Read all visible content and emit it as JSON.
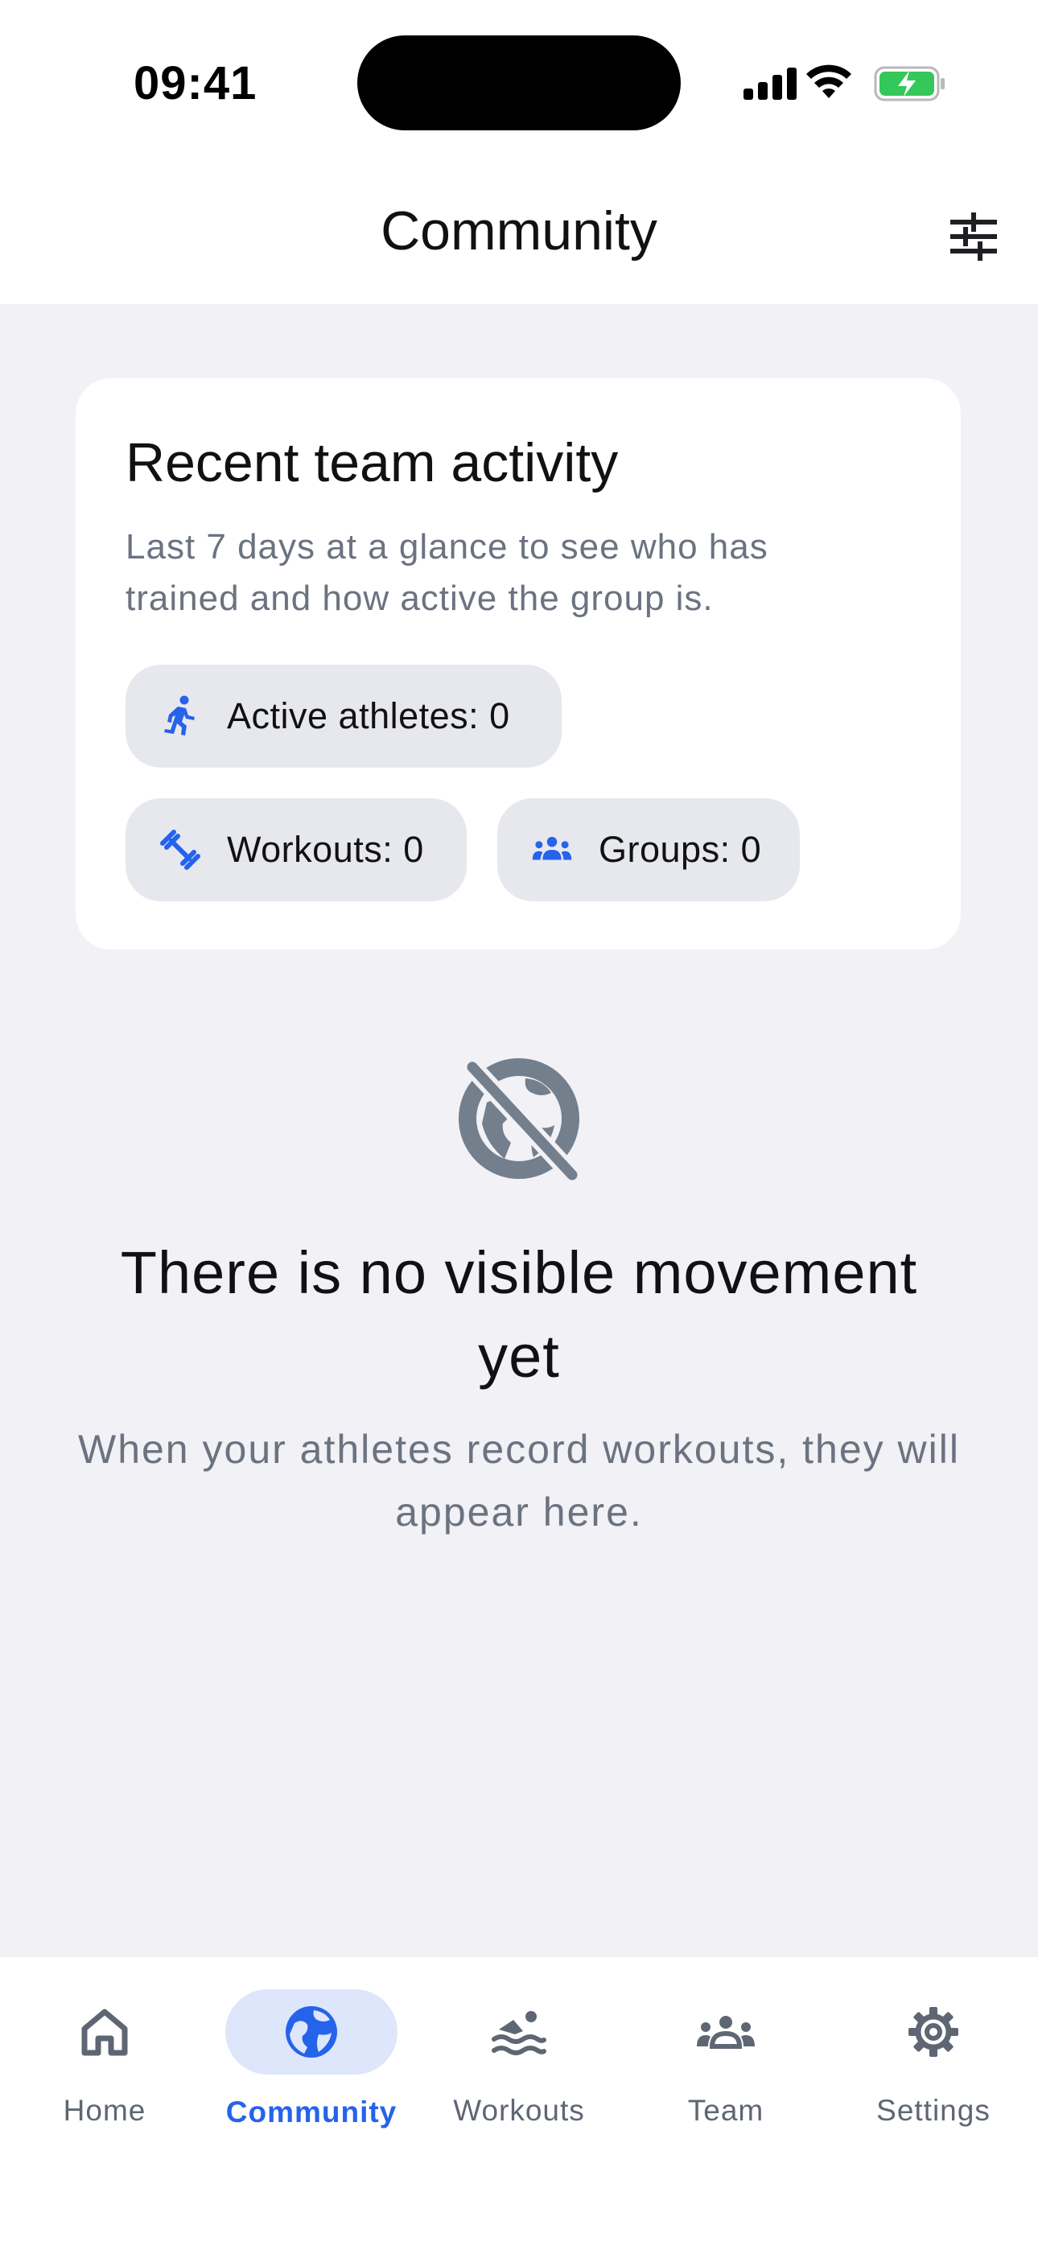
{
  "status_bar": {
    "time": "09:41"
  },
  "header": {
    "title": "Community",
    "filter_icon": "sliders-icon"
  },
  "activity_card": {
    "title": "Recent team activity",
    "description": "Last 7 days at a glance to see who has trained and how active the group is.",
    "chips": {
      "athletes": "Active athletes: 0",
      "workouts": "Workouts: 0",
      "groups": "Groups: 0"
    }
  },
  "empty_state": {
    "icon": "no-globe-icon",
    "title": "There is no visible movement yet",
    "description": "When your athletes record workouts, they will appear here."
  },
  "tab_bar": {
    "items": [
      {
        "label": "Home",
        "icon": "home-icon"
      },
      {
        "label": "Community",
        "icon": "globe-icon",
        "active": true
      },
      {
        "label": "Workouts",
        "icon": "swim-icon"
      },
      {
        "label": "Team",
        "icon": "team-icon"
      },
      {
        "label": "Settings",
        "icon": "gear-icon"
      }
    ]
  },
  "colors": {
    "accent": "#2563eb",
    "accent_bg": "#dde6fb",
    "background": "#f1f1f6",
    "chip_bg": "#e7e8ee",
    "muted_text": "#6b7280",
    "battery_green": "#34c759"
  }
}
